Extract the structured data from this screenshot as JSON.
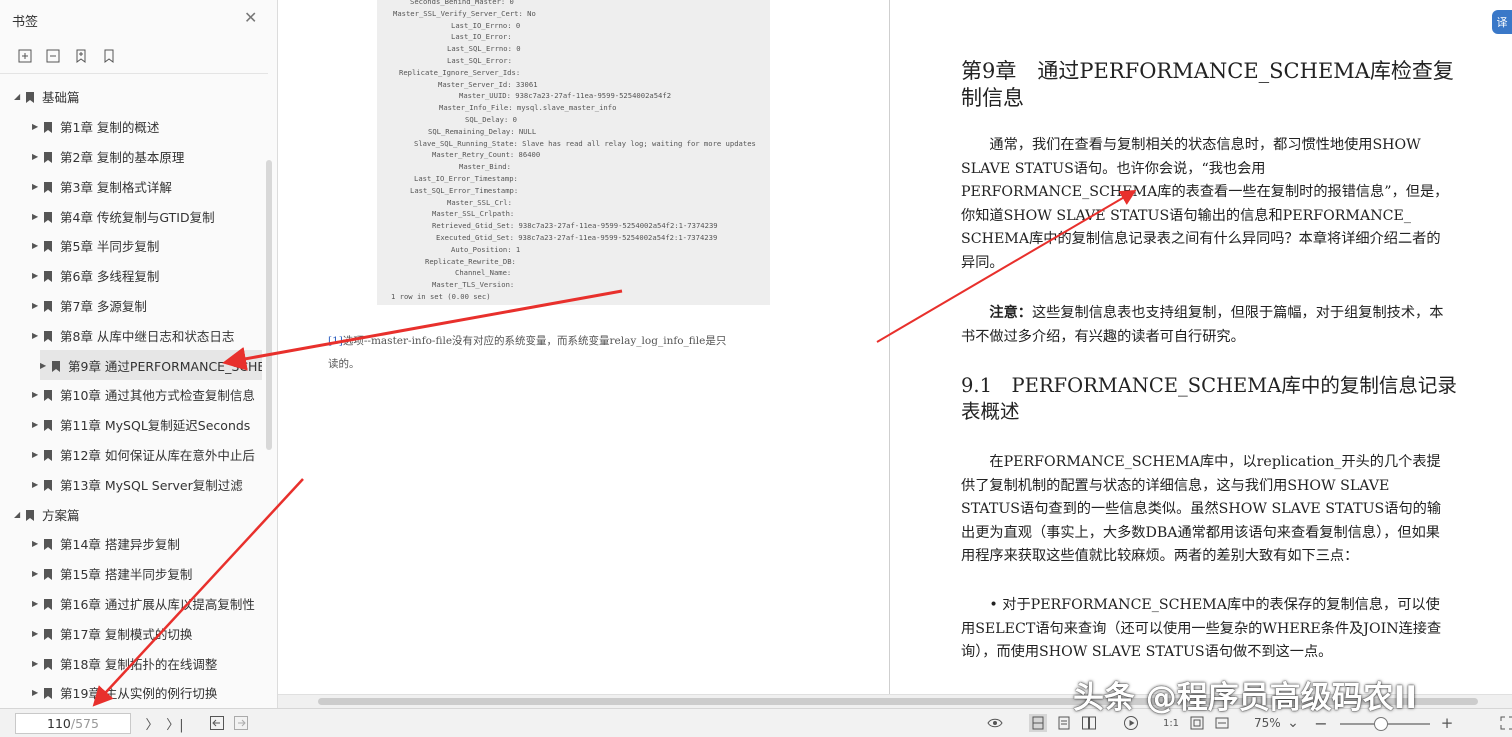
{
  "sidebar": {
    "title": "书签",
    "close_icon": "close-icon",
    "tools": [
      "expand-all-icon",
      "collapse-all-icon",
      "add-bookmark-icon",
      "bookmark-icon"
    ],
    "items": [
      {
        "label": "基础篇",
        "level": 0,
        "expanded": true
      },
      {
        "label": "第1章 复制的概述",
        "level": 1
      },
      {
        "label": "第2章 复制的基本原理",
        "level": 1
      },
      {
        "label": "第3章 复制格式详解",
        "level": 1
      },
      {
        "label": "第4章 传统复制与GTID复制",
        "level": 1
      },
      {
        "label": "第5章 半同步复制",
        "level": 1
      },
      {
        "label": "第6章 多线程复制",
        "level": 1
      },
      {
        "label": "第7章 多源复制",
        "level": 1
      },
      {
        "label": "第8章 从库中继日志和状态日志",
        "level": 1
      },
      {
        "label": "第9章 通过PERFORMANCE_SCHE",
        "level": 1,
        "selected": true
      },
      {
        "label": "第10章 通过其他方式检查复制信息",
        "level": 1
      },
      {
        "label": "第11章 MySQL复制延迟Seconds",
        "level": 1
      },
      {
        "label": "第12章 如何保证从库在意外中止后",
        "level": 1
      },
      {
        "label": "第13章 MySQL Server复制过滤",
        "level": 1
      },
      {
        "label": "方案篇",
        "level": 0,
        "expanded": true
      },
      {
        "label": "第14章 搭建异步复制",
        "level": 1
      },
      {
        "label": "第15章 搭建半同步复制",
        "level": 1
      },
      {
        "label": "第16章 通过扩展从库以提高复制性",
        "level": 1
      },
      {
        "label": "第17章 复制模式的切换",
        "level": 1
      },
      {
        "label": "第18章 复制拓扑的在线调整",
        "level": 1
      },
      {
        "label": "第19章 主从实例的例行切换",
        "level": 1
      }
    ]
  },
  "left_page": {
    "code_lines": [
      {
        "text": "Seconds_Behind_Master: 0",
        "indent": 33
      },
      {
        "text": "Master_SSL_Verify_Server_Cert: No",
        "indent": 16
      },
      {
        "text": "Last_IO_Errno: 0",
        "indent": 74
      },
      {
        "text": "Last_IO_Error:",
        "indent": 74
      },
      {
        "text": "Last_SQL_Errno: 0",
        "indent": 70
      },
      {
        "text": "Last_SQL_Error:",
        "indent": 70
      },
      {
        "text": "Replicate_Ignore_Server_Ids:",
        "indent": 22
      },
      {
        "text": "Master_Server_Id: 33061",
        "indent": 61
      },
      {
        "text": "Master_UUID: 938c7a23-27af-11ea-9599-5254002a54f2",
        "indent": 82
      },
      {
        "text": "Master_Info_File: mysql.slave_master_info",
        "indent": 62
      },
      {
        "text": "SQL_Delay: 0",
        "indent": 88
      },
      {
        "text": "SQL_Remaining_Delay: NULL",
        "indent": 51
      },
      {
        "text": "Slave_SQL_Running_State: Slave has read all relay log; waiting for more updates",
        "indent": 37
      },
      {
        "text": "Master_Retry_Count: 86400",
        "indent": 55
      },
      {
        "text": "Master_Bind:",
        "indent": 82
      },
      {
        "text": "Last_IO_Error_Timestamp:",
        "indent": 37
      },
      {
        "text": "Last_SQL_Error_Timestamp:",
        "indent": 33
      },
      {
        "text": "Master_SSL_Crl:",
        "indent": 70
      },
      {
        "text": "Master_SSL_Crlpath:",
        "indent": 55
      },
      {
        "text": "Retrieved_Gtid_Set: 938c7a23-27af-11ea-9599-5254002a54f2:1-7374239",
        "indent": 55
      },
      {
        "text": "Executed_Gtid_Set: 938c7a23-27af-11ea-9599-5254002a54f2:1-7374239",
        "indent": 59
      },
      {
        "text": "Auto_Position: 1",
        "indent": 74
      },
      {
        "text": "Replicate_Rewrite_DB:",
        "indent": 48
      },
      {
        "text": "Channel_Name:",
        "indent": 78
      },
      {
        "text": "Master_TLS_Version:",
        "indent": 55
      },
      {
        "text": "1 row in set (0.00 sec)",
        "indent": 14
      }
    ],
    "footnote_mark": "[1]",
    "footnote_line1": "选项--master-info-file没有对应的系统变量，而系统变量relay_log_info_file是只",
    "footnote_line2": "读的。"
  },
  "right_page": {
    "chapter_title": "第9章　通过PERFORMANCE_SCHEMA库检查复制信息",
    "para1": "通常，我们在查看与复制相关的状态信息时，都习惯性地使用SHOW SLAVE STATUS语句。也许你会说，“我也会用PERFORMANCE_SCHEMA库的表查看一些在复制时的报错信息”，但是，你知道SHOW SLAVE STATUS语句输出的信息和PERFORMANCE_ SCHEMA库中的复制信息记录表之间有什么异同吗？本章将详细介绍二者的异同。",
    "note_label": "注意：",
    "note_text": "这些复制信息表也支持组复制，但限于篇幅，对于组复制技术，本书不做过多介绍，有兴趣的读者可自行研究。",
    "section_title": "9.1　PERFORMANCE_SCHEMA库中的复制信息记录表概述",
    "para2": "在PERFORMANCE_SCHEMA库中，以replication_开头的几个表提供了复制机制的配置与状态的详细信息，这与我们用SHOW SLAVE STATUS语句查到的一些信息类似。虽然SHOW SLAVE STATUS语句的输出更为直观（事实上，大多数DBA通常都用该语句来查看复制信息），但如果用程序来获取这些值就比较麻烦。两者的差别大致有如下三点：",
    "bullet1": "• 对于PERFORMANCE_SCHEMA库中的表保存的复制信息，可以使用SELECT语句来查询（还可以使用一些复杂的WHERE条件及JOIN连接查询），而使用SHOW SLAVE STATUS语句做不到这一点。"
  },
  "bottom_bar": {
    "current_page": "110",
    "total_pages": "/575",
    "zoom": "75%",
    "zoom_level": 0.38,
    "icons": [
      "next-page-icon",
      "last-page-icon",
      "prev-view-icon",
      "next-view-icon",
      "eye-icon",
      "single-page-icon",
      "continuous-page-icon",
      "two-page-icon",
      "play-icon",
      "actual-size-icon",
      "fit-page-icon",
      "zoom-out-icon",
      "zoom-in-icon",
      "fullscreen-icon"
    ]
  },
  "watermark": "头条 @程序员高级码农II",
  "colors": {
    "arrow": "#e8302c",
    "selected": "#e6e6e6",
    "code_bg": "#eeeeee"
  }
}
